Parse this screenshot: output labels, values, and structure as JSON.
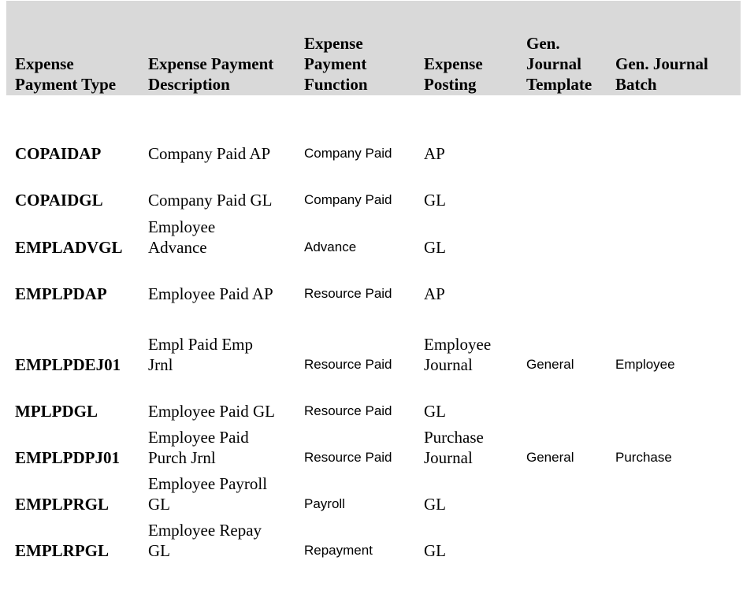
{
  "table": {
    "headers": [
      {
        "lines": [
          "Expense",
          "Payment Type"
        ]
      },
      {
        "lines": [
          "Expense Payment",
          "Description"
        ]
      },
      {
        "lines": [
          "Expense",
          "Payment",
          "Function"
        ]
      },
      {
        "lines": [
          "Expense",
          "Posting"
        ]
      },
      {
        "lines": [
          "Gen.",
          "Journal",
          "Template"
        ]
      },
      {
        "lines": [
          "Gen. Journal",
          "Batch"
        ]
      }
    ],
    "rows": [
      {
        "type": "COPAIDAP",
        "description": [
          "Company Paid AP"
        ],
        "function": "Company Paid",
        "posting": [
          "AP"
        ],
        "template": "",
        "batch": ""
      },
      {
        "type": "COPAIDGL",
        "description": [
          "Company Paid GL"
        ],
        "function": "Company Paid",
        "posting": [
          "GL"
        ],
        "template": "",
        "batch": ""
      },
      {
        "type": "EMPLADVGL",
        "description": [
          "Employee",
          "Advance"
        ],
        "function": "Advance",
        "posting": [
          "GL"
        ],
        "template": "",
        "batch": ""
      },
      {
        "type": "EMPLPDAP",
        "description": [
          "Employee Paid AP"
        ],
        "function": "Resource Paid",
        "posting": [
          "AP"
        ],
        "template": "",
        "batch": ""
      },
      {
        "type": "EMPLPDEJ01",
        "description": [
          "Empl Paid Emp",
          "Jrnl"
        ],
        "function": "Resource Paid",
        "posting": [
          "Employee",
          "Journal"
        ],
        "template": "General",
        "batch": "Employee"
      },
      {
        "type": "MPLPDGL",
        "description": [
          "Employee Paid GL"
        ],
        "function": "Resource Paid",
        "posting": [
          "GL"
        ],
        "template": "",
        "batch": ""
      },
      {
        "type": "EMPLPDPJ01",
        "description": [
          "Employee Paid",
          "Purch Jrnl"
        ],
        "function": "Resource Paid",
        "posting": [
          "Purchase",
          "Journal"
        ],
        "template": "General",
        "batch": "Purchase"
      },
      {
        "type": "EMPLPRGL",
        "description": [
          "Employee Payroll",
          "GL"
        ],
        "function": "Payroll",
        "posting": [
          "GL"
        ],
        "template": "",
        "batch": ""
      },
      {
        "type": "EMPLRPGL",
        "description": [
          "Employee Repay",
          "GL"
        ],
        "function": "Repayment",
        "posting": [
          "GL"
        ],
        "template": "",
        "batch": ""
      }
    ]
  }
}
